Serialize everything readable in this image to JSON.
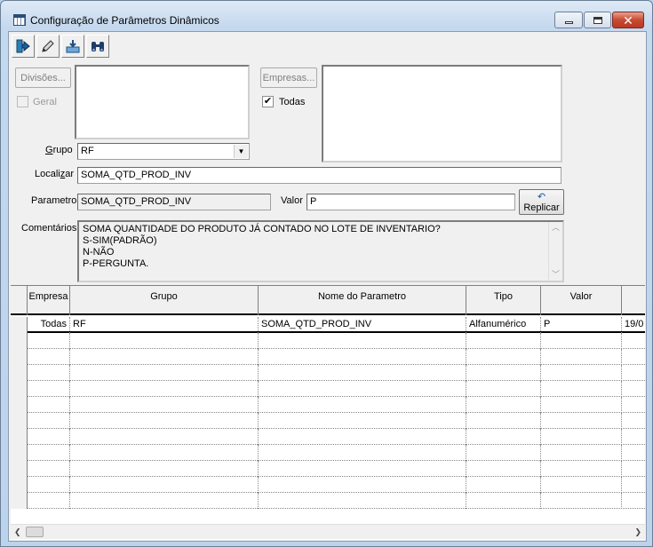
{
  "window": {
    "title": "Configuração de Parâmetros Dinâmicos"
  },
  "toolbar": {
    "icons": [
      "exit-icon",
      "edit-icon",
      "import-icon",
      "binoculars-icon"
    ]
  },
  "form": {
    "divisoes_label": "Divisões...",
    "geral_label": "Geral",
    "empresas_label": "Empresas...",
    "todas_label": "Todas",
    "todas_checked": "✔",
    "grupo_label": "Grupo",
    "grupo_value": "RF",
    "localizar_label": "Localizar",
    "localizar_value": "SOMA_QTD_PROD_INV",
    "parametro_label": "Parametro",
    "parametro_value": "SOMA_QTD_PROD_INV",
    "valor_label": "Valor",
    "valor_value": "P",
    "replicar_label": "Replicar",
    "comentarios_label": "Comentários",
    "comentarios_lines": [
      "SOMA QUANTIDADE DO PRODUTO JÁ CONTADO NO LOTE DE INVENTARIO?",
      "S-SIM(PADRÃO)",
      "N-NÃO",
      "P-PERGUNTA."
    ]
  },
  "grid": {
    "columns": [
      "Empresa",
      "Grupo",
      "Nome do Parametro",
      "Tipo",
      "Valor",
      ""
    ],
    "rows": [
      [
        "Todas",
        "RF",
        "SOMA_QTD_PROD_INV",
        "Alfanumérico",
        "P",
        "19/0"
      ]
    ]
  },
  "colors": {
    "title_bar": "#c4d8ee",
    "client_bg": "#f0f0f0",
    "close_button": "#c84a30"
  }
}
